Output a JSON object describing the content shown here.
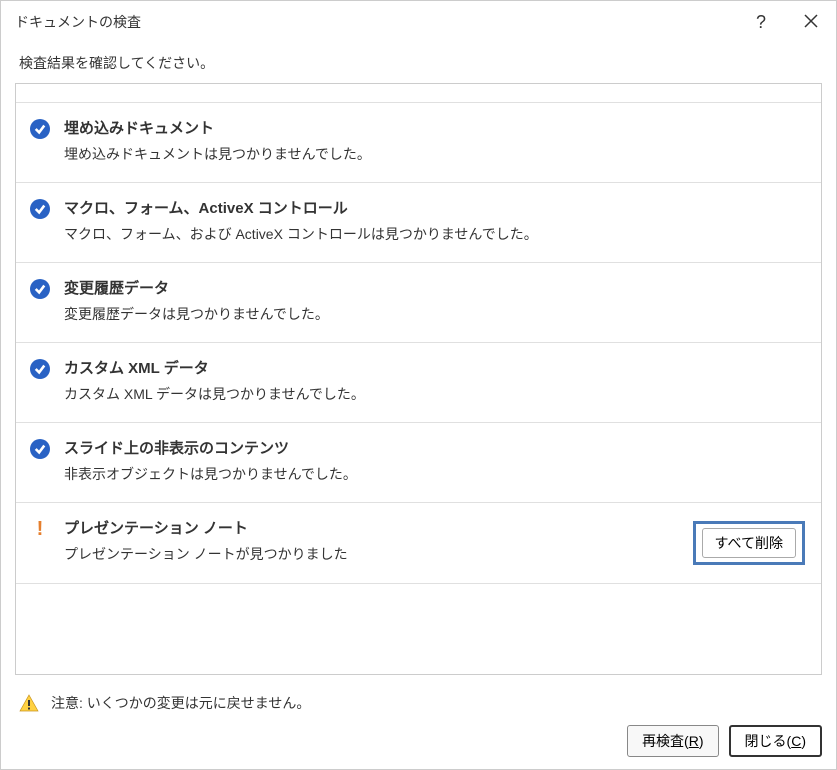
{
  "titlebar": {
    "title": "ドキュメントの検査"
  },
  "subheader": "検査結果を確認してください。",
  "items": [
    {
      "status": "ok",
      "title": "埋め込みドキュメント",
      "desc": "埋め込みドキュメントは見つかりませんでした。"
    },
    {
      "status": "ok",
      "title": "マクロ、フォーム、ActiveX コントロール",
      "desc": "マクロ、フォーム、および ActiveX コントロールは見つかりませんでした。"
    },
    {
      "status": "ok",
      "title": "変更履歴データ",
      "desc": "変更履歴データは見つかりませんでした。"
    },
    {
      "status": "ok",
      "title": "カスタム XML データ",
      "desc": "カスタム XML データは見つかりませんでした。"
    },
    {
      "status": "ok",
      "title": "スライド上の非表示のコンテンツ",
      "desc": "非表示オブジェクトは見つかりませんでした。"
    },
    {
      "status": "warn",
      "title": "プレゼンテーション ノート",
      "desc": "プレゼンテーション ノートが見つかりました",
      "action": "すべて削除"
    }
  ],
  "footer": {
    "warning": "注意: いくつかの変更は元に戻せません。",
    "reinspect_label": "再検査(R)",
    "reinspect_key": "R",
    "close_label": "閉じる(C)",
    "close_key": "C"
  }
}
